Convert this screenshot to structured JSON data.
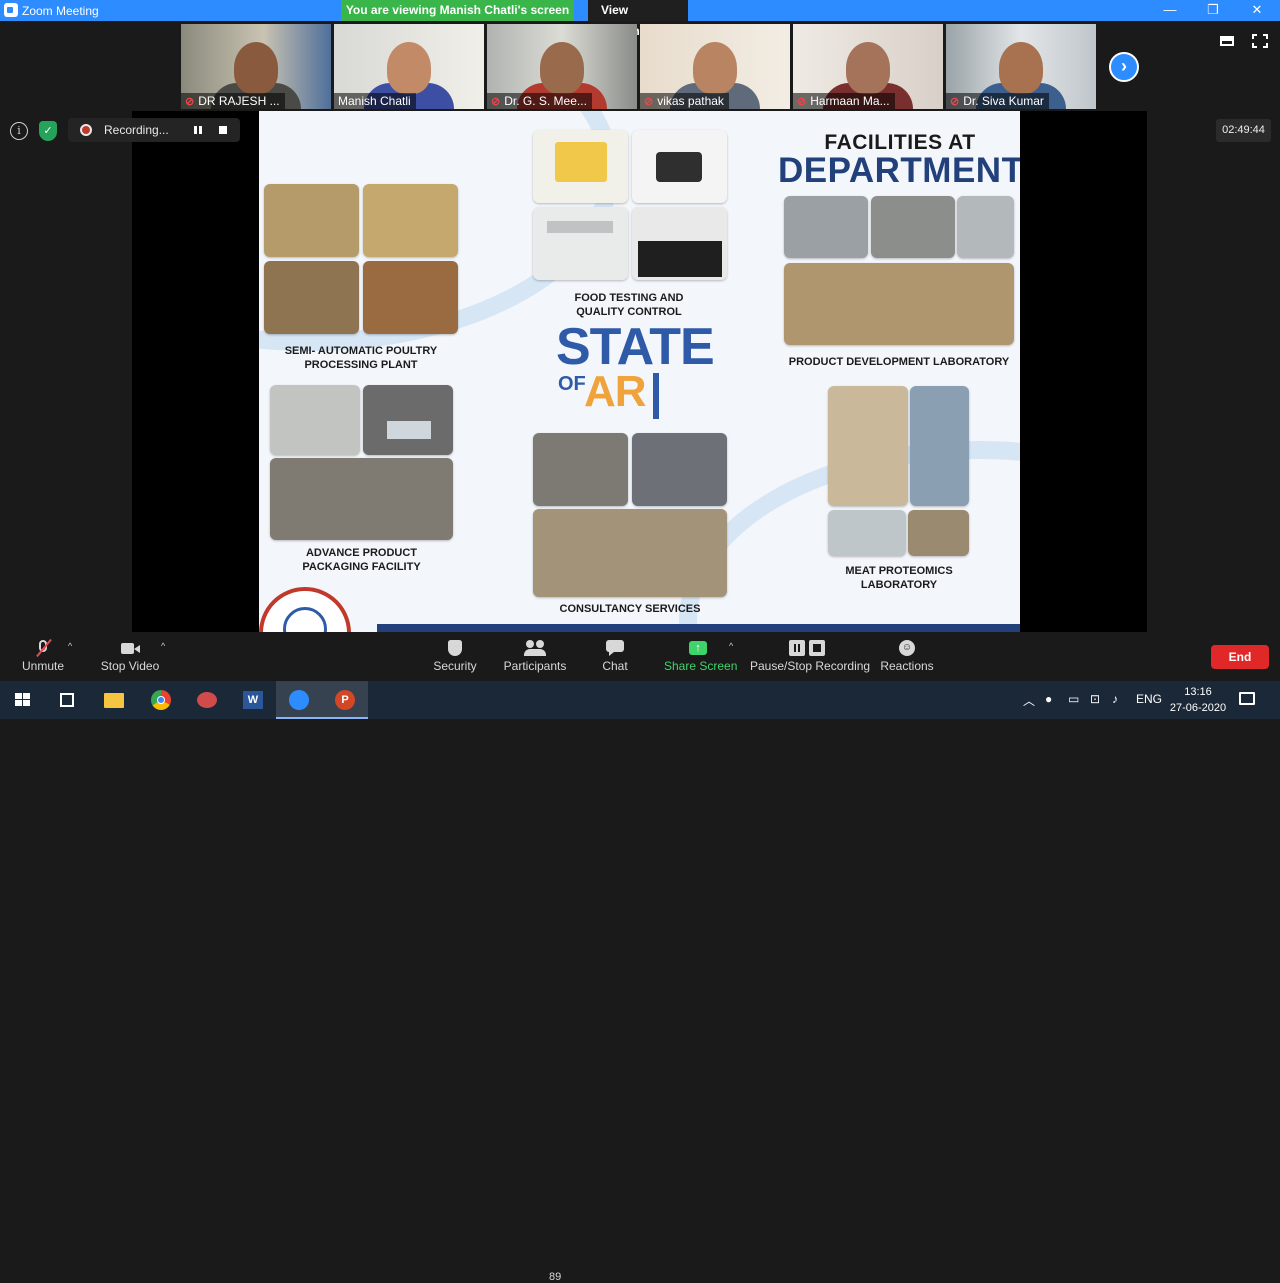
{
  "window": {
    "title": "Zoom Meeting",
    "viewing_banner": "You are viewing Manish Chatli's screen",
    "view_options": "View Options",
    "minimize": "—",
    "restore": "❐",
    "close": "✕"
  },
  "participants_strip": [
    {
      "name": "DR RAJESH ...",
      "muted": true
    },
    {
      "name": "Manish Chatli",
      "muted": false
    },
    {
      "name": "Dr. G. S. Mee...",
      "muted": true
    },
    {
      "name": "vikas pathak",
      "muted": true
    },
    {
      "name": "Harmaan Ma...",
      "muted": true
    },
    {
      "name": "Dr. Siva Kumar",
      "muted": true
    }
  ],
  "recording": {
    "label": "Recording...",
    "timer": "02:49:44"
  },
  "slide": {
    "facilities_line1": "FACILITIES AT",
    "facilities_line2": "DEPARTMENT",
    "state_word": "STATE",
    "of_word": "OF",
    "art_word": "AR",
    "captions": {
      "food_testing_1": "FOOD TESTING AND",
      "food_testing_2": "QUALITY CONTROL",
      "poultry_1": "SEMI- AUTOMATIC POULTRY",
      "poultry_2": "PROCESSING PLANT",
      "product_dev": "PRODUCT DEVELOPMENT LABORATORY",
      "packaging_1": "ADVANCE PRODUCT",
      "packaging_2": "PACKAGING FACILITY",
      "proteomics_1": "MEAT PROTEOMICS",
      "proteomics_2": "LABORATORY",
      "consultancy": "CONSULTANCY SERVICES"
    }
  },
  "toolbar": {
    "unmute": "Unmute",
    "stop_video": "Stop Video",
    "security": "Security",
    "participants": "Participants",
    "participants_count": "89",
    "chat": "Chat",
    "share_screen": "Share Screen",
    "pause_recording": "Pause/Stop Recording",
    "reactions": "Reactions",
    "end": "End"
  },
  "taskbar": {
    "language": "ENG",
    "time": "13:16",
    "date": "27-06-2020"
  },
  "colors": {
    "zoom_blue": "#2d8cff",
    "banner_green": "#39b54a",
    "end_red": "#e02828",
    "dept_navy": "#22407a",
    "art_orange": "#f0a33a"
  }
}
